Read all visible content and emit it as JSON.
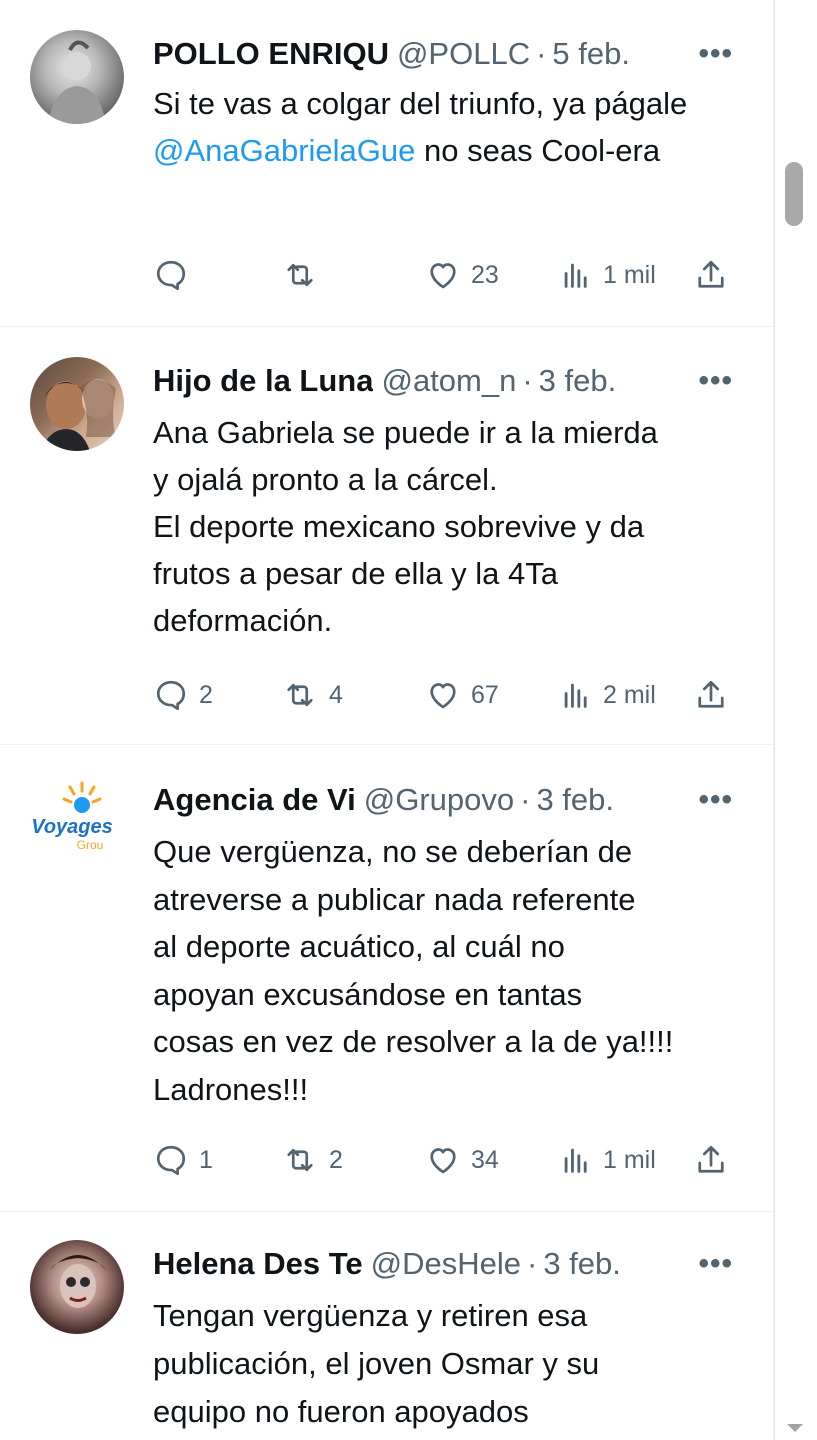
{
  "colors": {
    "accent": "#1d9bf0",
    "muted": "#536471",
    "text": "#0f1419",
    "divider": "#eff3f4"
  },
  "tweets": [
    {
      "name": "POLLO ENRIQU",
      "handle": "@POLLC",
      "sep": "·",
      "date": "5 feb.",
      "more": "•••",
      "text_before": "Si te vas a colgar del triunfo, ya págale ",
      "mention": "@AnaGabrielaGue",
      "text_after": " no seas Cool-era",
      "replies": "",
      "reposts": "",
      "likes": "23",
      "views": "1 mil"
    },
    {
      "name": "Hijo de la Luna",
      "handle": "@atom_n",
      "sep": "·",
      "date": "3 feb.",
      "more": "•••",
      "line1": "Ana Gabriela se puede ir a la mierda",
      "line2": "y ojalá pronto a la cárcel.",
      "line3": "El deporte mexicano sobrevive y da",
      "line4": "frutos a pesar de ella y la 4Ta",
      "line5": "deformación.",
      "replies": "2",
      "reposts": "4",
      "likes": "67",
      "views": "2 mil"
    },
    {
      "name": "Agencia de Vi",
      "handle": "@Grupovo",
      "sep": "·",
      "date": "3 feb.",
      "more": "•••",
      "avatar_text": "Voyages",
      "avatar_sub": "Grou",
      "line1": "Que vergüenza, no se deberían de",
      "line2": "atreverse a publicar nada referente",
      "line3": "al deporte acuático, al cuál no",
      "line4": "apoyan excusándose en tantas",
      "line5": "cosas en vez de resolver a la de ya!!!!",
      "line6": "Ladrones!!!",
      "replies": "1",
      "reposts": "2",
      "likes": "34",
      "views": "1 mil"
    },
    {
      "name": "Helena Des Te",
      "handle": "@DesHele",
      "sep": "·",
      "date": "3 feb.",
      "more": "•••",
      "line1": "Tengan vergüenza y retiren esa",
      "line2": "publicación, el joven Osmar y su",
      "line3": "equipo no fueron apoyados"
    }
  ]
}
